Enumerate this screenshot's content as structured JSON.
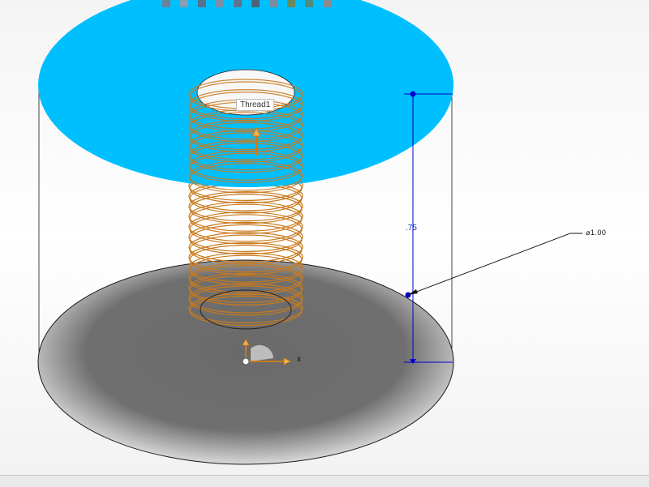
{
  "feature_label": "Thread1",
  "dimension_height": ".75",
  "dimension_diameter": "⌀1.00",
  "axis_x_label": "x",
  "toolbar_icons": [
    "zoom-icon",
    "zoom-area-icon",
    "previous-view-icon",
    "section-view-icon",
    "view-orientation-icon",
    "display-style-icon",
    "hide-show-icon",
    "appearance-icon",
    "scene-icon",
    "settings-icon"
  ],
  "colors": {
    "top_face": "#00bfff",
    "bottom_face": "#6e6e6e",
    "thread": "#c87a1e",
    "dimension": "#0000cc",
    "edge": "#1a1a1a"
  }
}
